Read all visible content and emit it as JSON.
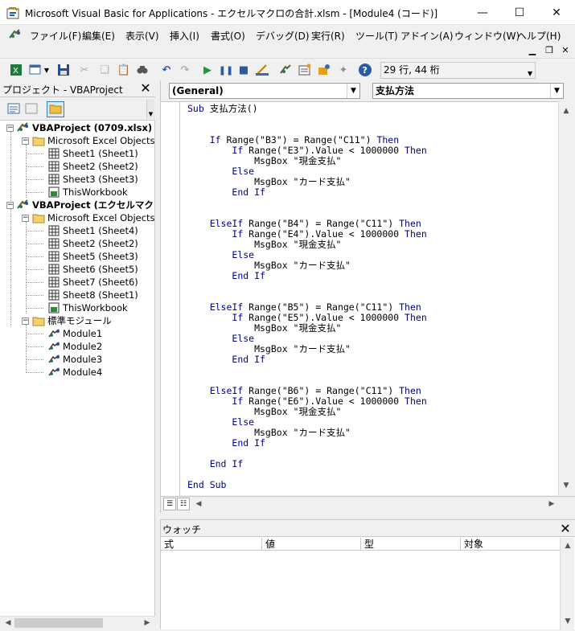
{
  "window": {
    "title": "Microsoft Visual Basic for Applications - エクセルマクロの合計.xlsm - [Module4 (コード)]",
    "minimize": "—",
    "maximize": "☐",
    "close": "✕"
  },
  "menu": [
    {
      "label": "ファイル(F)"
    },
    {
      "label": "編集(E)"
    },
    {
      "label": "表示(V)"
    },
    {
      "label": "挿入(I)"
    },
    {
      "label": "書式(O)"
    },
    {
      "label": "デバッグ(D)"
    },
    {
      "label": "実行(R)"
    },
    {
      "label": "ツール(T)"
    },
    {
      "label": "アドイン(A)"
    },
    {
      "label": "ウィンドウ(W)"
    },
    {
      "label": "ヘルプ(H)"
    }
  ],
  "toolbar": {
    "position": "29 行, 44 桁"
  },
  "project": {
    "title": "プロジェクト - VBAProject",
    "close": "✕",
    "tree": [
      {
        "label": "VBAProject (0709.xlsx)",
        "level": 0,
        "bold": true,
        "toggle": "−",
        "icon": "vbaproject-icon"
      },
      {
        "label": "Microsoft Excel Objects",
        "level": 1,
        "toggle": "−",
        "icon": "folder-icon"
      },
      {
        "label": "Sheet1 (Sheet1)",
        "level": 2,
        "icon": "sheet-icon"
      },
      {
        "label": "Sheet2 (Sheet2)",
        "level": 2,
        "icon": "sheet-icon"
      },
      {
        "label": "Sheet3 (Sheet3)",
        "level": 2,
        "icon": "sheet-icon"
      },
      {
        "label": "ThisWorkbook",
        "level": 2,
        "icon": "workbook-icon"
      },
      {
        "label": "VBAProject (エクセルマクロ",
        "level": 0,
        "bold": true,
        "toggle": "−",
        "icon": "vbaproject-icon"
      },
      {
        "label": "Microsoft Excel Objects",
        "level": 1,
        "toggle": "−",
        "icon": "folder-icon"
      },
      {
        "label": "Sheet1 (Sheet4)",
        "level": 2,
        "icon": "sheet-icon"
      },
      {
        "label": "Sheet2 (Sheet2)",
        "level": 2,
        "icon": "sheet-icon"
      },
      {
        "label": "Sheet5 (Sheet3)",
        "level": 2,
        "icon": "sheet-icon"
      },
      {
        "label": "Sheet6 (Sheet5)",
        "level": 2,
        "icon": "sheet-icon"
      },
      {
        "label": "Sheet7 (Sheet6)",
        "level": 2,
        "icon": "sheet-icon"
      },
      {
        "label": "Sheet8 (Sheet1)",
        "level": 2,
        "icon": "sheet-icon"
      },
      {
        "label": "ThisWorkbook",
        "level": 2,
        "icon": "workbook-icon"
      },
      {
        "label": "標準モジュール",
        "level": 1,
        "toggle": "−",
        "icon": "folder-icon"
      },
      {
        "label": "Module1",
        "level": 2,
        "icon": "module-icon"
      },
      {
        "label": "Module2",
        "level": 2,
        "icon": "module-icon"
      },
      {
        "label": "Module3",
        "level": 2,
        "icon": "module-icon"
      },
      {
        "label": "Module4",
        "level": 2,
        "icon": "module-icon"
      }
    ]
  },
  "code": {
    "object_dropdown": "(General)",
    "procedure_dropdown": "支払方法",
    "lines": [
      "Sub 支払方法()",
      "",
      "",
      "    If Range(\"B3\") = Range(\"C11\") Then",
      "        If Range(\"E3\").Value < 1000000 Then",
      "            MsgBox \"現金支払\"",
      "        Else",
      "            MsgBox \"カード支払\"",
      "        End If",
      "",
      "",
      "    ElseIf Range(\"B4\") = Range(\"C11\") Then",
      "        If Range(\"E4\").Value < 1000000 Then",
      "            MsgBox \"現金支払\"",
      "        Else",
      "            MsgBox \"カード支払\"",
      "        End If",
      "",
      "",
      "    ElseIf Range(\"B5\") = Range(\"C11\") Then",
      "        If Range(\"E5\").Value < 1000000 Then",
      "            MsgBox \"現金支払\"",
      "        Else",
      "            MsgBox \"カード支払\"",
      "        End If",
      "",
      "",
      "    ElseIf Range(\"B6\") = Range(\"C11\") Then",
      "        If Range(\"E6\").Value < 1000000 Then",
      "            MsgBox \"現金支払\"",
      "        Else",
      "            MsgBox \"カード支払\"",
      "        End If",
      "",
      "    End If",
      "",
      "End Sub"
    ]
  },
  "watch": {
    "title": "ウォッチ",
    "close": "✕",
    "columns": [
      "式",
      "値",
      "型",
      "対象"
    ]
  }
}
